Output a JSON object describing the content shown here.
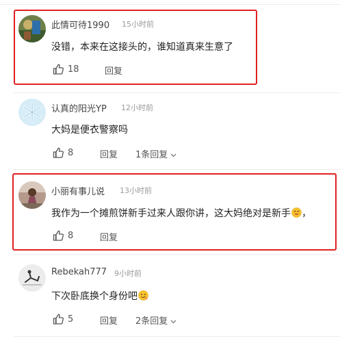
{
  "comments": [
    {
      "user": "此情可待1990",
      "time": "15小时前",
      "text": "没错，本来在这接头的，谁知道真来生意了",
      "likes": "18",
      "reply": "回复",
      "thread": ""
    },
    {
      "user": "认真的阳光YP",
      "time": "12小时前",
      "text": "大妈是便衣警察吗",
      "likes": "8",
      "reply": "回复",
      "thread": "1条回复"
    },
    {
      "user": "小丽有事儿说",
      "time": "13小时前",
      "text": "我作为一个摊煎饼新手过来人跟你讲，这大妈绝对是新手",
      "text_tail": "，",
      "likes": "8",
      "reply": "回复",
      "thread": ""
    },
    {
      "user": "Rebekah777",
      "time": "9小时前",
      "text": "下次卧底换个身份吧",
      "likes": "5",
      "reply": "回复",
      "thread": "2条回复"
    }
  ],
  "icons": {
    "like": "thumbs-up-icon",
    "chevron": "chevron-down-icon",
    "emoji_grin": "grinning-emoji-icon",
    "emoji_smirk": "smirk-emoji-icon"
  },
  "colors": {
    "highlight_border": "#e02020",
    "divider": "#ececec",
    "meta": "#9a9a9a"
  }
}
